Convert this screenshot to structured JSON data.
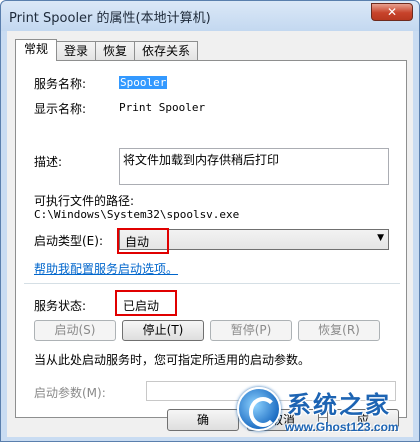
{
  "window": {
    "title": "Print Spooler 的属性(本地计算机)",
    "close_glyph": "✕"
  },
  "tabs": [
    {
      "label": "常规",
      "active": true
    },
    {
      "label": "登录",
      "active": false
    },
    {
      "label": "恢复",
      "active": false
    },
    {
      "label": "依存关系",
      "active": false
    }
  ],
  "general": {
    "service_name_label": "服务名称:",
    "service_name_value": "Spooler",
    "display_name_label": "显示名称:",
    "display_name_value": "Print Spooler",
    "description_label": "描述:",
    "description_value": "将文件加载到内存供稍后打印",
    "exe_path_label": "可执行文件的路径:",
    "exe_path_value": "C:\\Windows\\System32\\spoolsv.exe",
    "startup_type_label": "启动类型(E):",
    "startup_type_value": "自动",
    "help_link": "帮助我配置服务启动选项。",
    "status_label": "服务状态:",
    "status_value": "已启动",
    "buttons": {
      "start": "启动(S)",
      "stop": "停止(T)",
      "pause": "暂停(P)",
      "resume": "恢复(R)"
    },
    "hint": "当从此处启动服务时，您可指定所适用的启动参数。",
    "start_params_label": "启动参数(M):",
    "start_params_value": ""
  },
  "footer": {
    "ok_label": "确",
    "cancel_label": "取消",
    "apply_label": "应"
  },
  "watermark": {
    "title": "系统之家",
    "url": "www.Ghost123.com"
  }
}
